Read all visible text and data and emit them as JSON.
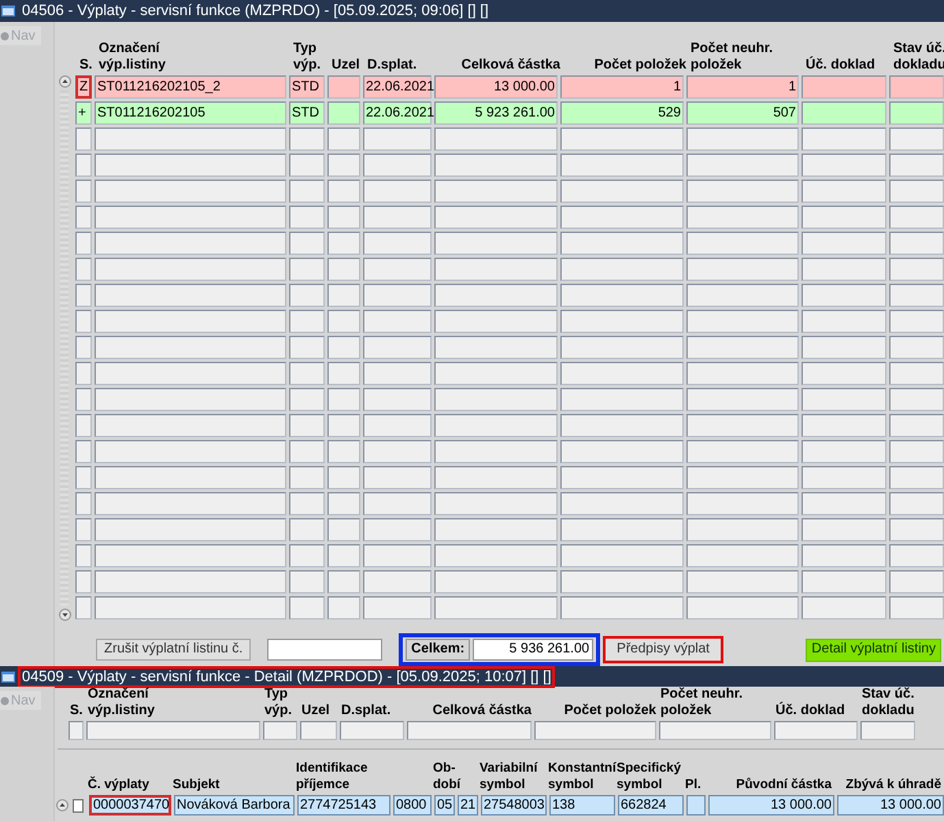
{
  "main_window": {
    "title": "04506 - Výplaty - servisní funkce (MZPRDO) - [05.09.2025; 09:06] [] []",
    "highlighted": false,
    "nav": "Nav",
    "columns": [
      {
        "label": "S.",
        "kind": "text"
      },
      {
        "label": "Označení\nvýp.listiny",
        "kind": "text"
      },
      {
        "label": "Typ\nvýp.",
        "kind": "text"
      },
      {
        "label": "Uzel",
        "kind": "text"
      },
      {
        "label": "D.splat.",
        "kind": "text"
      },
      {
        "label": "Celková částka",
        "kind": "number"
      },
      {
        "label": "Počet položek",
        "kind": "number"
      },
      {
        "label": "Počet neuhr.\npoložek",
        "kind": "text"
      },
      {
        "label": "Úč. doklad",
        "kind": "text"
      },
      {
        "label": "Stav úč.\ndokladu",
        "kind": "text"
      }
    ],
    "rows": [
      {
        "cells": [
          {
            "kind": "text",
            "text": "Z"
          },
          {
            "kind": "text",
            "text": "ST011216202105_2"
          },
          {
            "kind": "text",
            "text": "STD"
          },
          {
            "kind": "empty"
          },
          {
            "kind": "text",
            "text": "22.06.2021"
          },
          {
            "kind": "number",
            "text": "13 000.00"
          },
          {
            "kind": "number",
            "text": "1"
          },
          {
            "kind": "number",
            "text": "1"
          },
          {
            "kind": "empty"
          },
          {
            "kind": "empty"
          }
        ],
        "color": "#ffc0c0",
        "focused": true
      },
      {
        "cells": [
          {
            "kind": "text",
            "text": "+"
          },
          {
            "kind": "text",
            "text": "ST011216202105"
          },
          {
            "kind": "text",
            "text": "STD"
          },
          {
            "kind": "empty"
          },
          {
            "kind": "text",
            "text": "22.06.2021"
          },
          {
            "kind": "number",
            "text": "5 923 261.00"
          },
          {
            "kind": "number",
            "text": "529"
          },
          {
            "kind": "number",
            "text": "507"
          },
          {
            "kind": "empty"
          },
          {
            "kind": "empty"
          }
        ],
        "color": "#c0ffc0",
        "focused": false
      }
    ],
    "cancel_button": {
      "label": "Zrušit výplatní listinu č.",
      "highlighted": false
    },
    "total": {
      "label": "Celkem:",
      "value": "5 936 261.00",
      "highlighted": true
    },
    "prescriptions_button": {
      "label": "Předpisy výplat",
      "highlighted": true
    },
    "detail_button": {
      "label": "Detail výplatní listiny",
      "highlighted": false
    }
  },
  "detail_window": {
    "title": "04509 - Výplaty - servisní funkce - Detail (MZPRDOD) - [05.09.2025; 10:07] [] []",
    "highlighted": true,
    "nav": "Nav",
    "header_columns": [
      {
        "label": "S.",
        "kind": "text"
      },
      {
        "label": "Označení\nvýp.listiny",
        "kind": "text"
      },
      {
        "label": "Typ\nvýp.",
        "kind": "text"
      },
      {
        "label": "Uzel",
        "kind": "text"
      },
      {
        "label": "D.splat.",
        "kind": "text"
      },
      {
        "label": "Celková částka",
        "kind": "number"
      },
      {
        "label": "Počet položek",
        "kind": "number"
      },
      {
        "label": "Počet neuhr.\npoložek",
        "kind": "text"
      },
      {
        "label": "Úč. doklad",
        "kind": "text"
      },
      {
        "label": "Stav úč.\ndokladu",
        "kind": "text"
      }
    ],
    "columns": [
      {
        "label": "Č. výplaty",
        "kind": "text"
      },
      {
        "label": "Subjekt",
        "kind": "text"
      },
      {
        "label": "Identifikace\npříjemce",
        "kind": "text"
      },
      {
        "kind": "unlabeled"
      },
      {
        "label": "Ob-\ndobí",
        "kind": "text"
      },
      {
        "kind": "unlabeled"
      },
      {
        "label": "Variabilní\nsymbol",
        "kind": "text"
      },
      {
        "label": "Konstantní\nsymbol",
        "kind": "text"
      },
      {
        "label": "Specifický\nsymbol",
        "kind": "text"
      },
      {
        "label": "Pl.",
        "kind": "text"
      },
      {
        "label": "Původní částka",
        "kind": "number"
      },
      {
        "label": "Zbývá k úhradě",
        "kind": "number"
      }
    ],
    "rows": [
      {
        "checked": false,
        "focused": true,
        "cells": [
          {
            "kind": "text",
            "text": "0000037470"
          },
          {
            "kind": "text",
            "text": "Nováková Barbora"
          },
          {
            "kind": "text",
            "text": "2774725143"
          },
          {
            "kind": "text",
            "text": "0800"
          },
          {
            "kind": "text",
            "text": "05"
          },
          {
            "kind": "text",
            "text": "21"
          },
          {
            "kind": "text",
            "text": "27548003"
          },
          {
            "kind": "text",
            "text": "138"
          },
          {
            "kind": "text",
            "text": "662824"
          },
          {
            "kind": "empty"
          },
          {
            "kind": "number",
            "text": "13 000.00"
          },
          {
            "kind": "number",
            "text": "13 000.00"
          }
        ]
      }
    ]
  }
}
